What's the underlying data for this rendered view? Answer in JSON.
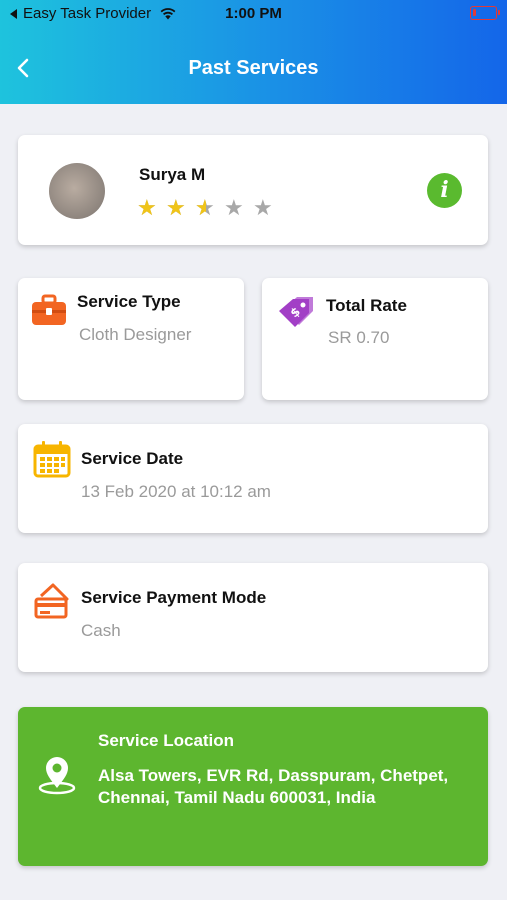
{
  "status_bar": {
    "carrier": "Easy Task Provider",
    "time": "1:00 PM",
    "battery_level": 0.12
  },
  "header": {
    "title": "Past Services"
  },
  "provider": {
    "name": "Surya M",
    "rating": 2.5,
    "max_rating": 5
  },
  "service_type": {
    "label": "Service Type",
    "value": "Cloth Designer"
  },
  "total_rate": {
    "label": "Total Rate",
    "value": "SR 0.70"
  },
  "service_date": {
    "label": "Service Date",
    "value": "13 Feb 2020 at 10:12 am"
  },
  "payment_mode": {
    "label": "Service Payment Mode",
    "value": "Cash"
  },
  "location": {
    "label": "Service Location",
    "address": "Alsa Towers, EVR Rd, Dasspuram, Chetpet, Chennai, Tamil Nadu 600031, India"
  },
  "colors": {
    "accent_green": "#5db62f",
    "star_gold": "#f0c419",
    "icon_orange": "#f26522",
    "icon_purple": "#a23fc6",
    "icon_yellow": "#f7b500"
  },
  "icons": [
    "back-chevron-icon",
    "info-icon",
    "briefcase-icon",
    "price-tag-icon",
    "calendar-icon",
    "credit-card-icon",
    "location-pin-icon"
  ]
}
